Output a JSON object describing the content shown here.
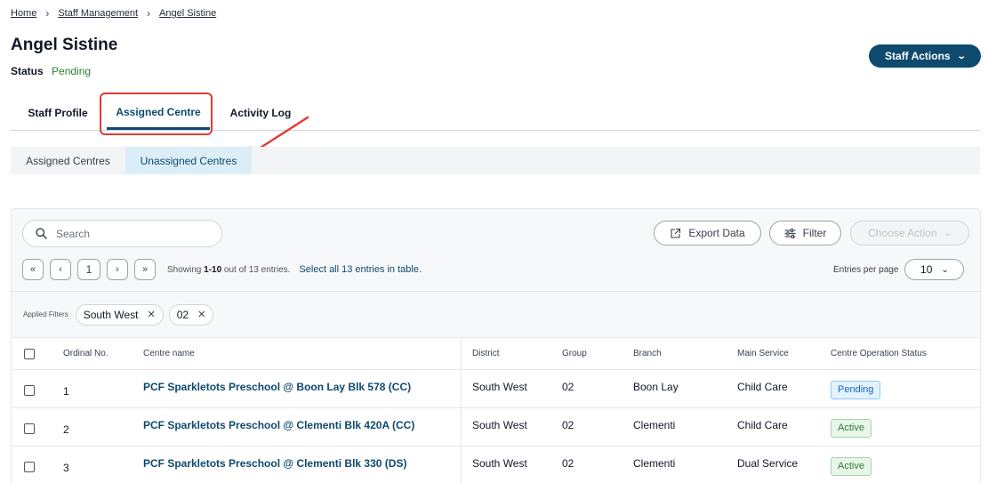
{
  "breadcrumb": [
    {
      "label": "Home"
    },
    {
      "label": "Staff Management"
    },
    {
      "label": "Angel Sistine"
    }
  ],
  "page": {
    "title": "Angel Sistine",
    "status_label": "Status",
    "status_value": "Pending"
  },
  "header": {
    "staff_actions_label": "Staff Actions"
  },
  "tabs": [
    {
      "label": "Staff Profile",
      "active": false
    },
    {
      "label": "Assigned Centre",
      "active": true
    },
    {
      "label": "Activity Log",
      "active": false
    }
  ],
  "subtabs": [
    {
      "label": "Assigned Centres",
      "active": false
    },
    {
      "label": "Unassigned Centres",
      "active": true
    }
  ],
  "toolbar": {
    "search_placeholder": "Search",
    "export_label": "Export Data",
    "filter_label": "Filter",
    "choose_action_label": "Choose Action"
  },
  "pagination": {
    "first": "«",
    "prev": "‹",
    "current_page": "1",
    "next": "›",
    "last": "»",
    "showing_prefix": "Showing ",
    "showing_range": "1-10",
    "showing_suffix": " out of 13 entries.",
    "select_all": "Select all 13 entries in table.",
    "entries_per_page_label": "Entries per page",
    "entries_per_page_value": "10"
  },
  "applied_filters": {
    "label": "Applied Filters",
    "chips": [
      "South West",
      "02"
    ]
  },
  "table": {
    "columns": [
      "Ordinal No.",
      "Centre name",
      "District",
      "Group",
      "Branch",
      "Main Service",
      "Centre Operation Status"
    ],
    "rows": [
      {
        "ordinal": "1",
        "centre": "PCF Sparkletots Preschool @ Boon Lay Blk 578 (CC)",
        "district": "South West",
        "group": "02",
        "branch": "Boon Lay",
        "service": "Child Care",
        "status": "Pending"
      },
      {
        "ordinal": "2",
        "centre": "PCF Sparkletots Preschool @ Clementi Blk 420A (CC)",
        "district": "South West",
        "group": "02",
        "branch": "Clementi",
        "service": "Child Care",
        "status": "Active"
      },
      {
        "ordinal": "3",
        "centre": "PCF Sparkletots Preschool @ Clementi Blk 330 (DS)",
        "district": "South West",
        "group": "02",
        "branch": "Clementi",
        "service": "Dual Service",
        "status": "Active"
      }
    ]
  },
  "colors": {
    "primary": "#0e4a6e",
    "highlight": "#e53935",
    "status_pending": "#1565c0",
    "status_active": "#2e7d32"
  }
}
